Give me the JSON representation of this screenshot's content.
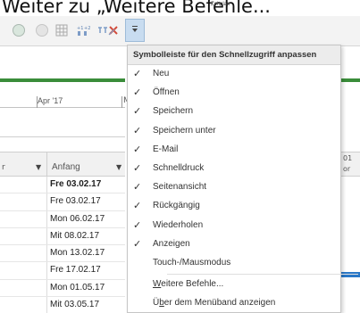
{
  "caption": {
    "text": "Weiter zu „Weitere Befehle...",
    "small_label": "Zeitplan"
  },
  "colors": {
    "accent_green": "#3a8d3a",
    "dropdown_highlight": "#c8dcf0",
    "bar_blue": "#2a78c8"
  },
  "qat": {
    "icons": [
      "circle-icon",
      "circle-icon",
      "table-icon",
      "sort-icon",
      "link-icon",
      "unlink-icon",
      "customize-qat-icon"
    ]
  },
  "timeline": {
    "label_apr": "Apr '17",
    "label_m": "M"
  },
  "grid": {
    "header_left": "r",
    "header_start": "Anfang",
    "right_header_1": "01",
    "right_header_2": "or",
    "rows": [
      {
        "value": "Fre 03.02.17",
        "bold": true
      },
      {
        "value": "Fre 03.02.17",
        "bold": false
      },
      {
        "value": "Mon 06.02.17",
        "bold": false
      },
      {
        "value": "Mit 08.02.17",
        "bold": false
      },
      {
        "value": "Mon 13.02.17",
        "bold": false
      },
      {
        "value": "Fre 17.02.17",
        "bold": false
      },
      {
        "value": "Mon 01.05.17",
        "bold": false
      },
      {
        "value": "Mit 03.05.17",
        "bold": false
      }
    ]
  },
  "menu": {
    "title": "Symbolleiste für den Schnellzugriff anpassen",
    "items": [
      {
        "label": "Neu",
        "checked": true
      },
      {
        "label": "Öffnen",
        "checked": true
      },
      {
        "label": "Speichern",
        "checked": true
      },
      {
        "label": "Speichern unter",
        "checked": true
      },
      {
        "label": "E-Mail",
        "checked": true
      },
      {
        "label": "Schnelldruck",
        "checked": true
      },
      {
        "label": "Seitenansicht",
        "checked": true
      },
      {
        "label": "Rückgängig",
        "checked": true
      },
      {
        "label": "Wiederholen",
        "checked": true
      },
      {
        "label": "Anzeigen",
        "checked": true
      },
      {
        "label": "Touch-/Mausmodus",
        "checked": false
      }
    ],
    "more_commands": "Weitere Befehle...",
    "show_below_ribbon": "Über dem Menüband anzeigen",
    "check_symbol": "✓"
  }
}
